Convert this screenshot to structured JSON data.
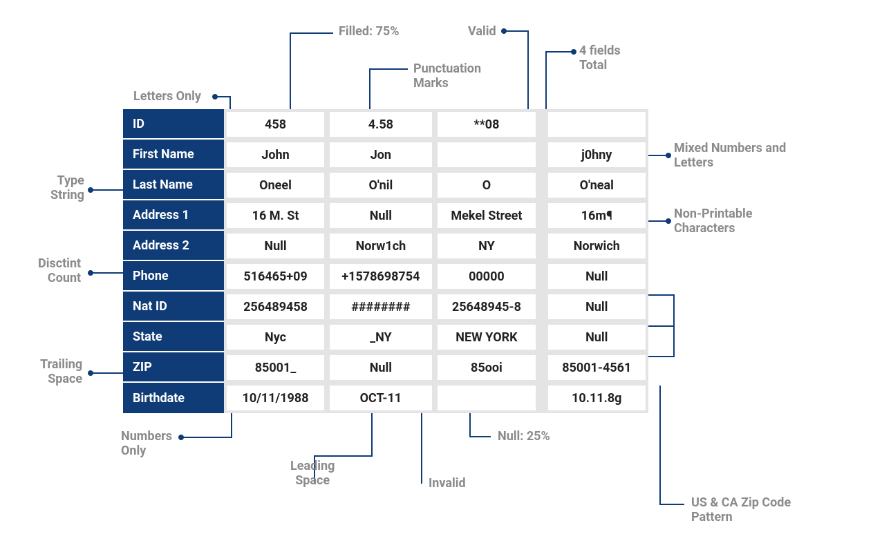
{
  "table": {
    "rows": [
      {
        "label": "ID",
        "c1": "458",
        "c2": "4.58",
        "c3": "**08",
        "c4": ""
      },
      {
        "label": "First Name",
        "c1": "John",
        "c2": "Jon",
        "c3": "",
        "c4": "j0hny"
      },
      {
        "label": "Last Name",
        "c1": "Oneel",
        "c2": "O'nil",
        "c3": "O",
        "c4": "O'neal"
      },
      {
        "label": "Address 1",
        "c1": "16 M. St",
        "c2": "Null",
        "c3": "Mekel Street",
        "c4": "16m¶"
      },
      {
        "label": "Address 2",
        "c1": "Null",
        "c2": "Norw1ch",
        "c3": "NY",
        "c4": "Norwich"
      },
      {
        "label": "Phone",
        "c1": "516465+09",
        "c2": "+1578698754",
        "c3": "00000",
        "c4": "Null"
      },
      {
        "label": "Nat ID",
        "c1": "256489458",
        "c2": "########",
        "c3": "25648945-8",
        "c4": "Null"
      },
      {
        "label": "State",
        "c1": "Nyc",
        "c2": "_NY",
        "c3": "NEW YORK",
        "c4": "Null"
      },
      {
        "label": "ZIP",
        "c1": "85001_",
        "c2": "Null",
        "c3": "85ooi",
        "c4": "85001-4561"
      },
      {
        "label": "Birthdate",
        "c1": "10/11/1988",
        "c2": "OCT-11",
        "c3": "",
        "c4": "10.11.8g"
      }
    ]
  },
  "annotations": {
    "filled": "Filled: 75%",
    "valid": "Valid",
    "punctuation": "Punctuation\nMarks",
    "fields_total": "4 fields\nTotal",
    "letters_only": "Letters Only",
    "type_string": "Type\nString",
    "mixed": "Mixed Numbers and\nLetters",
    "non_printable": "Non-Printable\nCharacters",
    "distinct_count": "Disctint\nCount",
    "trailing_space": "Trailing\nSpace",
    "numbers_only": "Numbers\nOnly",
    "leading_space": "Leading\nSpace",
    "invalid": "Invalid",
    "null_pct": "Null: 25%",
    "zip_pattern": "US & CA Zip Code\nPattern"
  }
}
